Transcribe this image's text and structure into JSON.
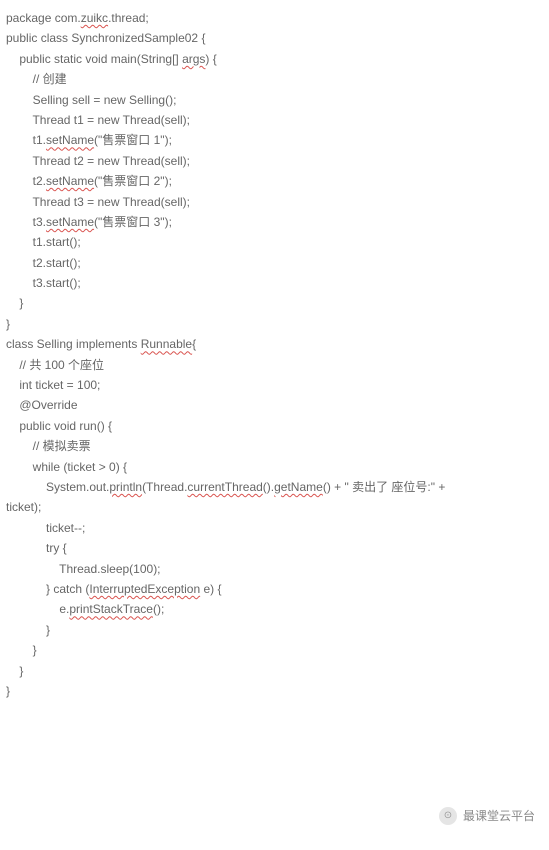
{
  "code": {
    "l1": "package com.",
    "l1b": "zuikc",
    "l1c": ".thread;",
    "l2": "",
    "l3": "public class SynchronizedSample02 {",
    "l4a": "    public static void main(String[] ",
    "l4b": "args",
    "l4c": ") {",
    "l5": "        // 创建",
    "l6": "        Selling sell = new Selling();",
    "l7": "",
    "l8": "        Thread t1 = new Thread(sell);",
    "l9a": "        t1.",
    "l9b": "setName",
    "l9c": "(\"售票窗口 1\");",
    "l10": "        Thread t2 = new Thread(sell);",
    "l11a": "        t2.",
    "l11b": "setName",
    "l11c": "(\"售票窗口 2\");",
    "l12": "        Thread t3 = new Thread(sell);",
    "l13a": "        t3.",
    "l13b": "setName",
    "l13c": "(\"售票窗口 3\");",
    "l14": "        t1.start();",
    "l15": "        t2.start();",
    "l16": "        t3.start();",
    "l17": "    }",
    "l18": "",
    "l19": "}",
    "l20": "",
    "l21a": "class Selling implements ",
    "l21b": "Runnable",
    "l21c": "{",
    "l22": "    // 共 100 个座位",
    "l23": "    int ticket = 100;",
    "l24": "",
    "l25": "    @Override",
    "l26": "    public void run() {",
    "l27": "        // 模拟卖票",
    "l28": "        while (ticket > 0) {",
    "l29": "",
    "l30a": "            System.out.",
    "l30b": "println",
    "l30c": "(Thread.",
    "l30d": "currentThread",
    "l30e": "().",
    "l30f": "getName",
    "l30g": "() + \" 卖出了 座位号:\" +",
    "l31": "ticket);",
    "l32": "            ticket--;",
    "l33": "",
    "l34": "            try {",
    "l35": "                Thread.sleep(100);",
    "l36a": "            } catch (",
    "l36b": "InterruptedException",
    "l36c": " e) {",
    "l37a": "                e.",
    "l37b": "printStackTrace",
    "l37c": "();",
    "l38": "            }",
    "l39": "        }",
    "l40": "    }",
    "l41": "}"
  },
  "watermark": {
    "icon": "⊙",
    "text": "最课堂云平台"
  }
}
